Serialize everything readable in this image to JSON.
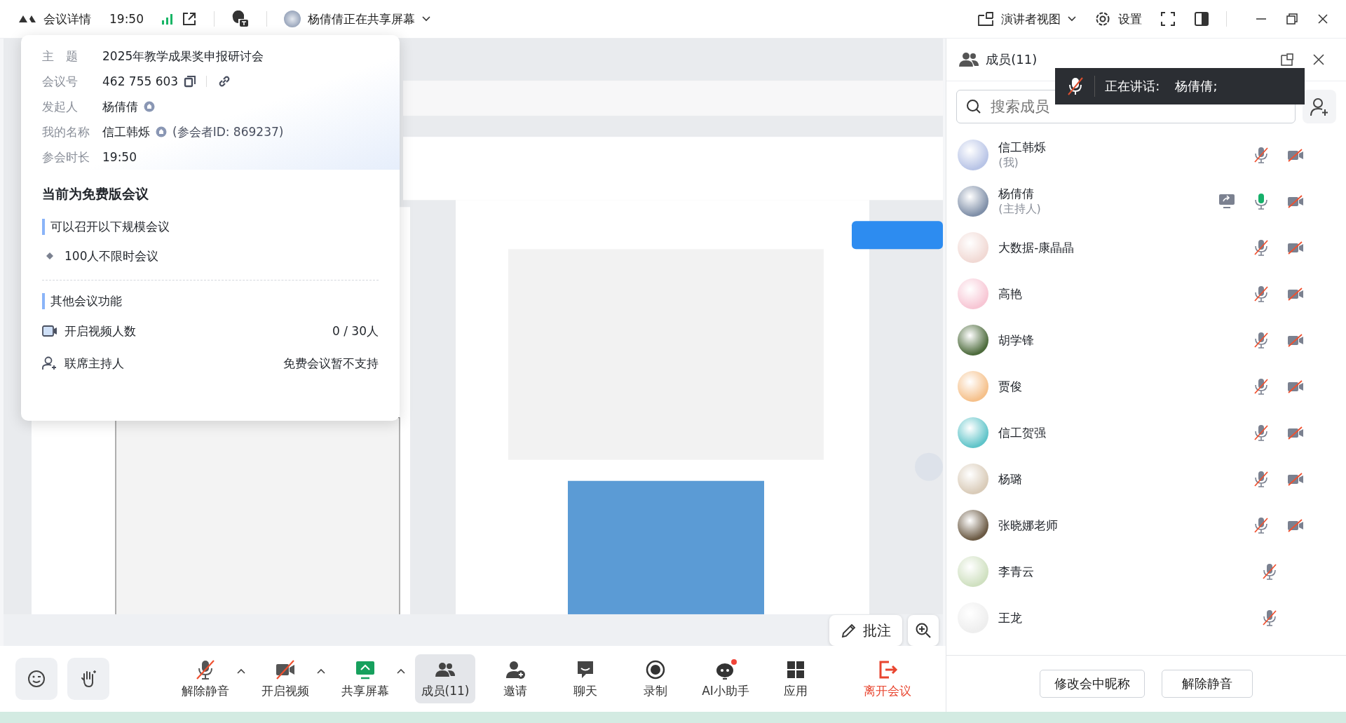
{
  "top_bar": {
    "meeting_details": "会议详情",
    "time": "19:50",
    "sharing_status": "杨倩倩正在共享屏幕",
    "presenter_view": "演讲者视图",
    "settings": "设置"
  },
  "meeting_info": {
    "rows": [
      {
        "label": "主　题",
        "value": "2025年教学成果奖申报研讨会",
        "kind": "plain"
      },
      {
        "label": "会议号",
        "value": "462 755 603",
        "kind": "number"
      },
      {
        "label": "发起人",
        "value": "杨倩倩",
        "kind": "person"
      },
      {
        "label": "我的名称",
        "value": "信工韩烁",
        "kind": "person",
        "extra": "(参会者ID: 869237)"
      },
      {
        "label": "参会时长",
        "value": "19:50",
        "kind": "plain"
      }
    ],
    "plan_title": "当前为免费版会议",
    "capacity_heading": "可以召开以下规模会议",
    "capacity_item": "100人不限时会议",
    "other_heading": "其他会议功能",
    "features": [
      {
        "kind": "video",
        "label": "开启视频人数",
        "value": "0 / 30人"
      },
      {
        "kind": "cohost",
        "label": "联席主持人",
        "value": "免费会议暂不支持"
      }
    ]
  },
  "shared_screen": {
    "kind": "picture",
    "annotate": "批注"
  },
  "toolbar": {
    "items": [
      {
        "kind": "emoji",
        "selected": false
      },
      {
        "kind": "hand",
        "selected": false
      },
      {
        "kind": "mic",
        "label": "解除静音",
        "off": true,
        "menu": true,
        "selected": false
      },
      {
        "kind": "video",
        "label": "开启视频",
        "off": true,
        "menu": true,
        "selected": false
      },
      {
        "kind": "share",
        "label": "共享屏幕",
        "menu": true,
        "selected": false
      },
      {
        "kind": "members",
        "label": "成员(11)",
        "selected": true
      },
      {
        "kind": "invite",
        "label": "邀请",
        "selected": false
      },
      {
        "kind": "chat",
        "label": "聊天",
        "selected": false
      },
      {
        "kind": "record",
        "label": "录制",
        "selected": false
      },
      {
        "kind": "assistant",
        "label": "AI小助手",
        "badge": true,
        "selected": false
      },
      {
        "kind": "apps",
        "label": "应用",
        "selected": false
      },
      {
        "kind": "leave",
        "label": "离开会议",
        "selected": false
      }
    ]
  },
  "members_panel": {
    "title": "成员(11)",
    "search": {
      "placeholder": "搜索成员"
    },
    "speaking": {
      "label": "正在讲话:",
      "name": "杨倩倩;"
    },
    "members": [
      {
        "name": "信工韩烁",
        "role": "(我)",
        "mic_muted": true,
        "video_off": true
      },
      {
        "name": "杨倩倩",
        "role": "(主持人)",
        "sharing": true,
        "mic_muted": false,
        "video_off": true
      },
      {
        "name": "大数据-康晶晶",
        "mic_muted": true,
        "video_off": true
      },
      {
        "name": "高艳",
        "mic_muted": true,
        "video_off": true
      },
      {
        "name": "胡学锋",
        "mic_muted": true,
        "video_off": true
      },
      {
        "name": "贾俊",
        "mic_muted": true,
        "video_off": true
      },
      {
        "name": "信工贺强",
        "mic_muted": true,
        "video_off": true
      },
      {
        "name": "杨璐",
        "mic_muted": true,
        "video_off": true
      },
      {
        "name": "张晓娜老师",
        "mic_muted": true,
        "video_off": true
      },
      {
        "name": "李青云",
        "mic_muted": true
      },
      {
        "name": "王龙",
        "mic_muted": true
      }
    ],
    "buttons": [
      "修改会中昵称",
      "解除静音"
    ]
  }
}
